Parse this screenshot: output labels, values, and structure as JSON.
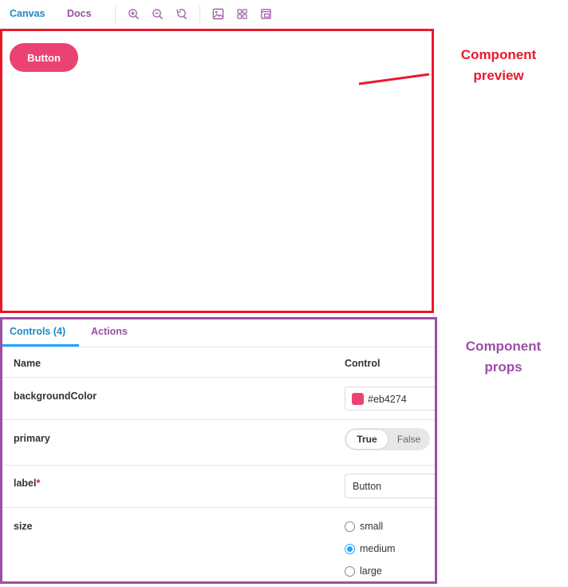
{
  "toolbar": {
    "tabs": [
      {
        "label": "Canvas",
        "color": "#1e88c7"
      },
      {
        "label": "Docs",
        "color": "#9b4fa6"
      }
    ],
    "icons": [
      "zoom-in-icon",
      "zoom-out-icon",
      "reset-zoom-icon",
      "background-icon",
      "grid-icon",
      "viewport-icon"
    ]
  },
  "preview": {
    "button_label": "Button",
    "button_color": "#eb4274",
    "frame_color": "#e8192c"
  },
  "annotations": {
    "preview_line1": "Component",
    "preview_line2": "preview",
    "preview_color": "#e8192c",
    "props_line1": "Component",
    "props_line2": "props",
    "props_color": "#9b4fa6"
  },
  "props_panel": {
    "tabs": [
      {
        "label": "Controls (4)",
        "active": true
      },
      {
        "label": "Actions",
        "active": false
      }
    ],
    "columns": {
      "name": "Name",
      "control": "Control"
    },
    "rows": [
      {
        "name": "backgroundColor",
        "control_type": "color",
        "value": "#eb4274"
      },
      {
        "name": "primary",
        "control_type": "boolean",
        "true_label": "True",
        "false_label": "False",
        "value": true
      },
      {
        "name": "label",
        "required_mark": "*",
        "control_type": "text",
        "value": "Button"
      },
      {
        "name": "size",
        "control_type": "radio",
        "options": [
          "small",
          "medium",
          "large"
        ],
        "selected": "medium"
      }
    ]
  }
}
